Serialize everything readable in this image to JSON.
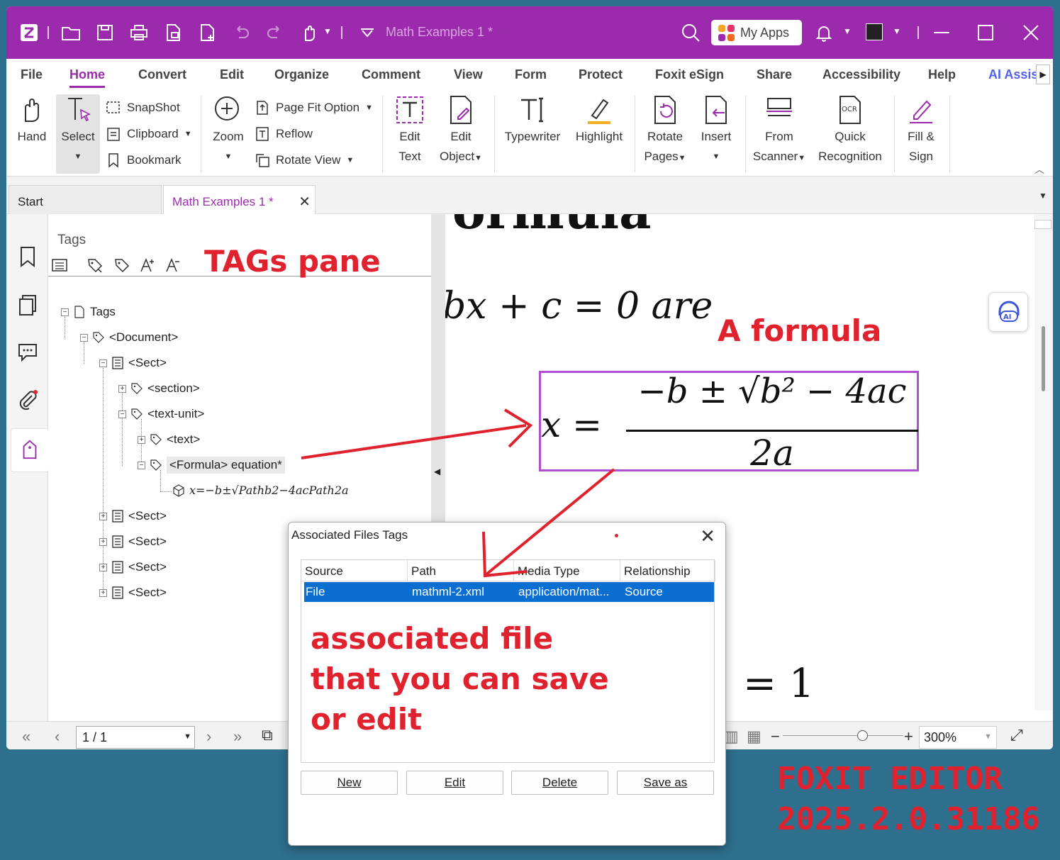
{
  "titlebar": {
    "document_title": "Math Examples 1 *",
    "my_apps_label": "My Apps",
    "color": "#9b2bac"
  },
  "menu": {
    "items": [
      "File",
      "Home",
      "Convert",
      "Edit",
      "Organize",
      "Comment",
      "View",
      "Form",
      "Protect",
      "Foxit eSign",
      "Share",
      "Accessibility",
      "Help",
      "AI Assis"
    ],
    "active": "Home"
  },
  "ribbon": {
    "hand": "Hand",
    "select": "Select",
    "snapshot": "SnapShot",
    "clipboard": "Clipboard",
    "bookmark": "Bookmark",
    "zoom": "Zoom",
    "page_fit": "Page Fit Option",
    "reflow": "Reflow",
    "rotate_view": "Rotate View",
    "edit_text": [
      "Edit",
      "Text"
    ],
    "edit_object": [
      "Edit",
      "Object"
    ],
    "typewriter": "Typewriter",
    "highlight": "Highlight",
    "rotate_pages": [
      "Rotate",
      "Pages"
    ],
    "insert": "Insert",
    "from_scanner": [
      "From",
      "Scanner"
    ],
    "quick_recognition": [
      "Quick",
      "Recognition"
    ],
    "fill_sign": [
      "Fill &",
      "Sign"
    ]
  },
  "tabs": {
    "start": "Start",
    "doc": "Math Examples 1 *"
  },
  "tags_pane": {
    "title": "Tags",
    "tree": [
      {
        "label": "Tags"
      },
      {
        "label": "<Document>"
      },
      {
        "label": "<Sect>"
      },
      {
        "label": "<section>"
      },
      {
        "label": "<text-unit>"
      },
      {
        "label": "<text>"
      },
      {
        "label": "<Formula> equation*"
      },
      {
        "label": "x=−b±√Pathb2−4acPath2a"
      },
      {
        "label": "<Sect>"
      },
      {
        "label": "<Sect>"
      },
      {
        "label": "<Sect>"
      },
      {
        "label": "<Sect>"
      }
    ]
  },
  "document": {
    "heading_fragment": "ormula",
    "line1": "bx + c = 0 are",
    "formula_lhs": "x =",
    "formula_num": "−b ± √b² − 4ac",
    "formula_den": "2a",
    "line3": "= 1"
  },
  "statusbar": {
    "page": "1 / 1",
    "zoom": "300%"
  },
  "dialog": {
    "title": "Associated Files Tags",
    "columns": [
      "Source",
      "Path",
      "Media Type",
      "Relationship"
    ],
    "rows": [
      {
        "source": "File",
        "path": "mathml-2.xml",
        "media_type": "application/mat...",
        "relationship": "Source"
      }
    ],
    "buttons": [
      "New",
      "Edit",
      "Delete",
      "Save as"
    ],
    "selection_color": "#0a6fd0"
  },
  "annotations": {
    "tags_pane": "TAGs pane",
    "formula": "A formula",
    "assoc_line1": "associated file",
    "assoc_line2": "that you can save",
    "assoc_line3": "or edit",
    "version_line1": "FOXIT EDITOR",
    "version_line2": "2025.2.0.31186",
    "color": "#e0222e"
  }
}
